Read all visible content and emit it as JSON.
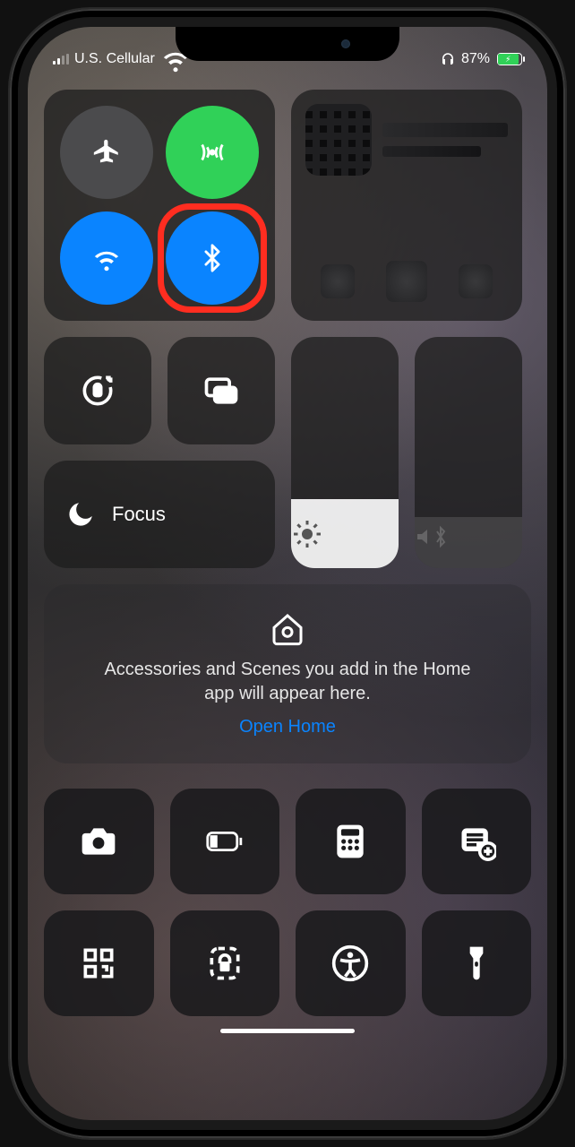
{
  "status": {
    "carrier": "U.S. Cellular",
    "battery_pct": "87%",
    "headphones_icon": "headphones-icon",
    "wifi_icon": "wifi-icon",
    "charging": true
  },
  "connectivity": {
    "airplane": {
      "icon": "airplane-icon",
      "active": false
    },
    "cellular": {
      "icon": "antenna-icon",
      "active": true,
      "color": "#30d158"
    },
    "wifi": {
      "icon": "wifi-icon",
      "active": true,
      "color": "#0a84ff"
    },
    "bluetooth": {
      "icon": "bluetooth-icon",
      "active": true,
      "color": "#0a84ff",
      "highlighted": true
    }
  },
  "media": {
    "title_line1": "",
    "title_line2": "",
    "controls": {
      "prev": "previous-track-icon",
      "playpause": "play-pause-icon",
      "next": "next-track-icon"
    }
  },
  "controls": {
    "orientation_lock": "orientation-lock-icon",
    "screen_mirroring": "screen-mirroring-icon",
    "focus_label": "Focus",
    "focus_icon": "moon-icon",
    "brightness_icon": "brightness-icon",
    "volume_icon": "volume-bluetooth-icon"
  },
  "home": {
    "icon": "home-icon",
    "message": "Accessories and Scenes you add in the Home app will appear here.",
    "link_label": "Open Home"
  },
  "bottom_row": [
    {
      "name": "camera",
      "icon": "camera-icon"
    },
    {
      "name": "low-power",
      "icon": "battery-low-icon"
    },
    {
      "name": "calculator",
      "icon": "calculator-icon"
    },
    {
      "name": "notes",
      "icon": "note-add-icon"
    },
    {
      "name": "qr-scan",
      "icon": "qr-icon"
    },
    {
      "name": "guided-access",
      "icon": "guided-access-icon"
    },
    {
      "name": "accessibility",
      "icon": "accessibility-icon"
    },
    {
      "name": "flashlight",
      "icon": "flashlight-icon"
    }
  ],
  "annotation": {
    "highlight_target": "bluetooth-toggle",
    "highlight_color": "#ff2d20"
  }
}
